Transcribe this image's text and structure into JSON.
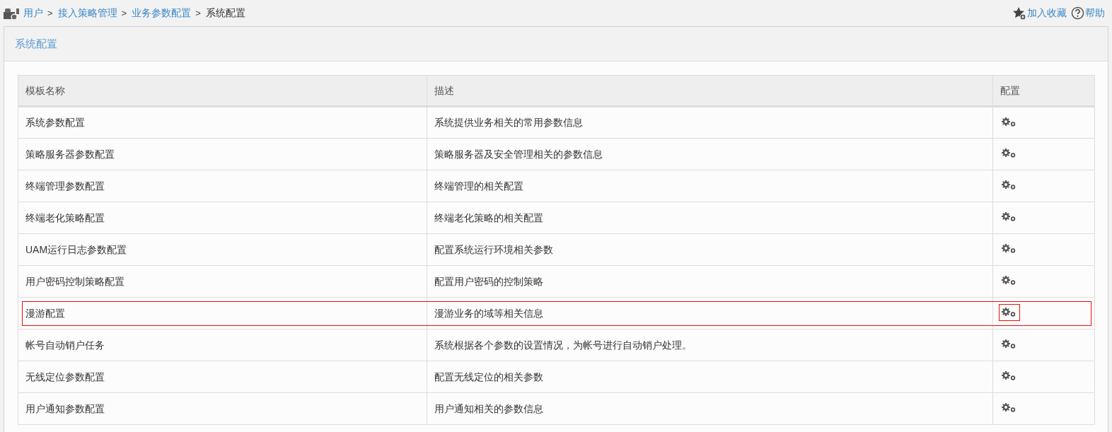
{
  "breadcrumb": {
    "links": [
      "用户",
      "接入策略管理",
      "业务参数配置"
    ],
    "separator": ">",
    "current": "系统配置"
  },
  "actions": [
    {
      "kind": "favorite",
      "label": "加入收藏"
    },
    {
      "kind": "help",
      "label": "帮助"
    }
  ],
  "panel": {
    "title": "系统配置"
  },
  "table": {
    "columns": [
      "模板名称",
      "描述",
      "配置"
    ],
    "rows": [
      {
        "name": "系统参数配置",
        "description": "系统提供业务相关的常用参数信息",
        "highlighted": false
      },
      {
        "name": "策略服务器参数配置",
        "description": "策略服务器及安全管理相关的参数信息",
        "highlighted": false
      },
      {
        "name": "终端管理参数配置",
        "description": "终端管理的相关配置",
        "highlighted": false
      },
      {
        "name": "终端老化策略配置",
        "description": "终端老化策略的相关配置",
        "highlighted": false
      },
      {
        "name": "UAM运行日志参数配置",
        "description": "配置系统运行环境相关参数",
        "highlighted": false
      },
      {
        "name": "用户密码控制策略配置",
        "description": "配置用户密码的控制策略",
        "highlighted": false
      },
      {
        "name": "漫游配置",
        "description": "漫游业务的域等相关信息",
        "highlighted": true
      },
      {
        "name": "帐号自动销户任务",
        "description": "系统根据各个参数的设置情况，为帐号进行自动销户处理。",
        "highlighted": false
      },
      {
        "name": "无线定位参数配置",
        "description": "配置无线定位的相关参数",
        "highlighted": false
      },
      {
        "name": "用户通知参数配置",
        "description": "用户通知相关的参数信息",
        "highlighted": false
      }
    ]
  }
}
